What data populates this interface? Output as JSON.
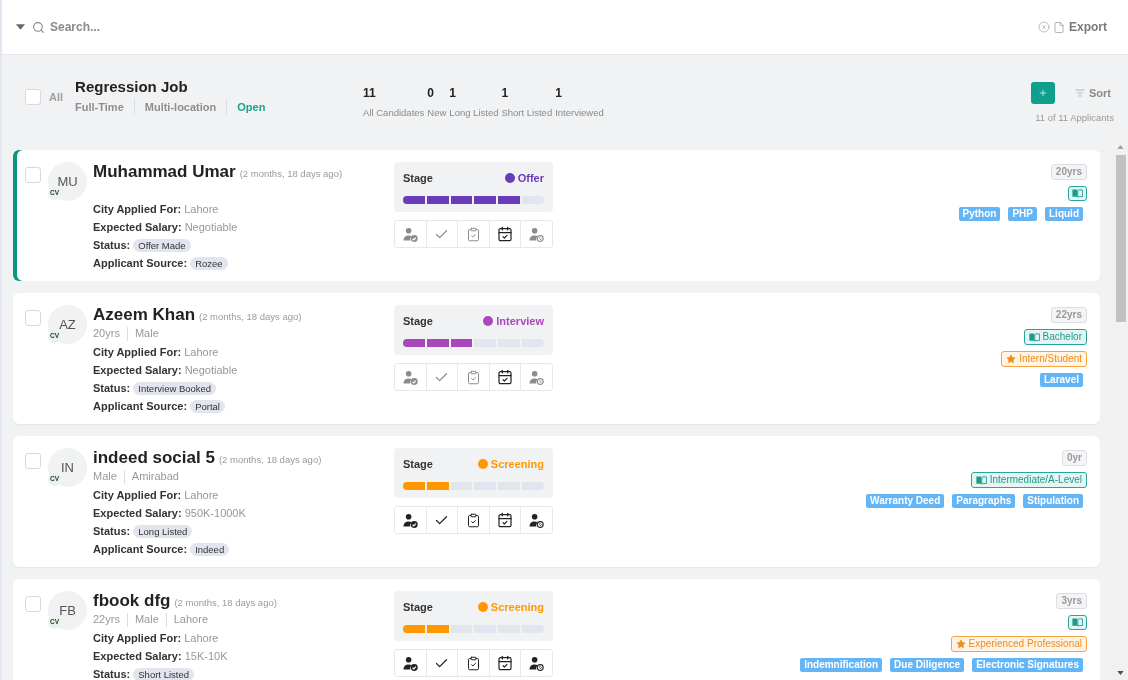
{
  "search": {
    "placeholder": "Search..."
  },
  "export_label": "Export",
  "job": {
    "select_all": {
      "label": "All",
      "checked": false
    },
    "title": "Regression Job",
    "tags": [
      "Full-Time",
      "Multi-location"
    ],
    "status": "Open"
  },
  "stats": [
    {
      "value": "11",
      "label": "All Candidates"
    },
    {
      "value": "0",
      "label": "New"
    },
    {
      "value": "1",
      "label": "Long Listed"
    },
    {
      "value": "1",
      "label": "Short Listed"
    },
    {
      "value": "1",
      "label": "Interviewed"
    }
  ],
  "sort_label": "Sort",
  "applicant_count": "11 of 11 Applicants",
  "applicants": [
    {
      "selected": true,
      "checked": false,
      "initials": "MU",
      "cv_label": "CV",
      "name": "Muhammad Umar",
      "applied_ago": "(2 months, 18 days ago)",
      "fields": [
        {
          "kind": "text",
          "label": "City Applied For:",
          "value": "Lahore"
        },
        {
          "kind": "text",
          "label": "Expected Salary:",
          "value": "Negotiable"
        },
        {
          "kind": "pill",
          "label": "Status:",
          "value": "Offer Made"
        },
        {
          "kind": "pill",
          "label": "Applicant Source:",
          "value": "Rozee"
        }
      ],
      "stage": {
        "label": "Stage",
        "name": "Offer",
        "color": "#6a3bb8",
        "level": 0.83
      },
      "actions": [
        {
          "kind": "shortlist",
          "disabled": true
        },
        {
          "kind": "approve",
          "disabled": true
        },
        {
          "kind": "assess",
          "disabled": true
        },
        {
          "kind": "schedule",
          "disabled": false
        },
        {
          "kind": "reject",
          "disabled": true
        }
      ],
      "chips": [
        {
          "kind": "age",
          "text": "20yrs"
        },
        {
          "kind": "education"
        }
      ],
      "skills": [
        "Python",
        "PHP",
        "Liquid"
      ]
    },
    {
      "selected": false,
      "checked": false,
      "initials": "AZ",
      "cv_label": "CV",
      "name": "Azeem Khan",
      "applied_ago": "(2 months, 18 days ago)",
      "meta": [
        "20yrs",
        "Male"
      ],
      "fields": [
        {
          "kind": "text",
          "label": "City Applied For:",
          "value": "Lahore"
        },
        {
          "kind": "text",
          "label": "Expected Salary:",
          "value": "Negotiable"
        },
        {
          "kind": "pill",
          "label": "Status:",
          "value": "Interview Booked"
        },
        {
          "kind": "pill",
          "label": "Applicant Source:",
          "value": "Portal"
        }
      ],
      "stage": {
        "label": "Stage",
        "name": "Interview",
        "color": "#ab47bc",
        "level": 0.5
      },
      "actions": [
        {
          "kind": "shortlist",
          "disabled": true
        },
        {
          "kind": "approve",
          "disabled": true
        },
        {
          "kind": "assess",
          "disabled": true
        },
        {
          "kind": "schedule",
          "disabled": false
        },
        {
          "kind": "reject",
          "disabled": true
        }
      ],
      "chips": [
        {
          "kind": "age",
          "text": "22yrs"
        },
        {
          "kind": "education",
          "text": "Bachelor"
        },
        {
          "kind": "experience",
          "text": "Intern/Student"
        }
      ],
      "skills": [
        "Laravel"
      ]
    },
    {
      "selected": false,
      "checked": false,
      "initials": "IN",
      "cv_label": "CV",
      "name": "indeed social 5",
      "applied_ago": "(2 months, 18 days ago)",
      "meta": [
        "Male",
        "Amirabad"
      ],
      "fields": [
        {
          "kind": "text",
          "label": "City Applied For:",
          "value": "Lahore"
        },
        {
          "kind": "text",
          "label": "Expected Salary:",
          "value": "950K-1000K"
        },
        {
          "kind": "pill",
          "label": "Status:",
          "value": "Long Listed"
        },
        {
          "kind": "pill",
          "label": "Applicant Source:",
          "value": "Indeed"
        }
      ],
      "stage": {
        "label": "Stage",
        "name": "Screening",
        "color": "#ff9800",
        "level": 0.33
      },
      "actions": [
        {
          "kind": "shortlist",
          "disabled": false
        },
        {
          "kind": "approve",
          "disabled": false
        },
        {
          "kind": "assess",
          "disabled": false
        },
        {
          "kind": "schedule",
          "disabled": false
        },
        {
          "kind": "reject",
          "disabled": false
        }
      ],
      "chips": [
        {
          "kind": "age",
          "text": "0yr"
        },
        {
          "kind": "education",
          "text": "Intermediate/A-Level"
        }
      ],
      "skills": [
        "Warranty Deed",
        "Paragraphs",
        "Stipulation"
      ]
    },
    {
      "selected": false,
      "checked": false,
      "initials": "FB",
      "cv_label": "CV",
      "name": "fbook dfg",
      "applied_ago": "(2 months, 18 days ago)",
      "meta": [
        "22yrs",
        "Male",
        "Lahore"
      ],
      "fields": [
        {
          "kind": "text",
          "label": "City Applied For:",
          "value": "Lahore"
        },
        {
          "kind": "text",
          "label": "Expected Salary:",
          "value": "15K-10K"
        },
        {
          "kind": "pill",
          "label": "Status:",
          "value": "Short Listed"
        }
      ],
      "stage": {
        "label": "Stage",
        "name": "Screening",
        "color": "#ff9800",
        "level": 0.33
      },
      "actions": [
        {
          "kind": "shortlist",
          "disabled": false
        },
        {
          "kind": "approve",
          "disabled": false
        },
        {
          "kind": "assess",
          "disabled": false
        },
        {
          "kind": "schedule",
          "disabled": false
        },
        {
          "kind": "reject",
          "disabled": false
        }
      ],
      "chips": [
        {
          "kind": "age",
          "text": "3yrs"
        },
        {
          "kind": "education"
        },
        {
          "kind": "experience",
          "text": "Experienced Professional"
        }
      ],
      "skills": [
        "Indemnification",
        "Due Diligence",
        "Electronic Signatures"
      ]
    }
  ]
}
